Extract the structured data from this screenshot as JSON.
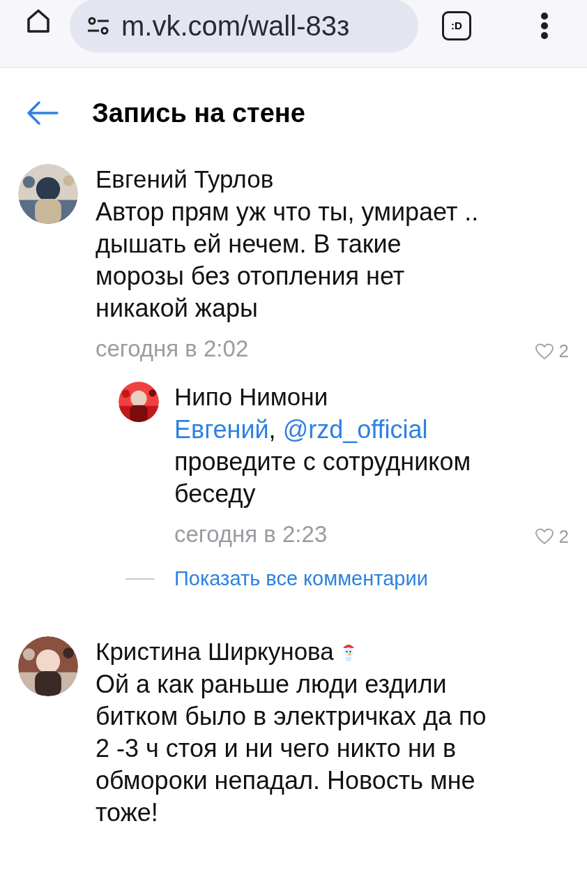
{
  "browser": {
    "url": "m.vk.com/wall-83з",
    "tab_switcher": ":D"
  },
  "header": {
    "title": "Запись на стене"
  },
  "comments": [
    {
      "kind": "comment",
      "author": "Евгений Турлов",
      "badge": false,
      "segments": [
        {
          "kind": "text",
          "text": "Автор прям уж что ты, умирает .. дышать ей нечем. В такие морозы без отопления нет никакой жары"
        }
      ],
      "time": "сегодня в 2:02",
      "likes": "2",
      "replies": [
        {
          "kind": "reply",
          "author": "Нипо Нимони",
          "badge": false,
          "segments": [
            {
              "kind": "link",
              "text": "Евгений",
              "suffix": ","
            },
            {
              "kind": "link",
              "text": "@rzd_official"
            },
            {
              "kind": "text",
              "text": "проведите с сотрудником беседу"
            }
          ],
          "time": "сегодня в 2:23",
          "likes": "2"
        }
      ],
      "show_all": "Показать все комментарии"
    },
    {
      "kind": "comment",
      "author": "Кристина Ширкунова",
      "badge": true,
      "segments": [
        {
          "kind": "text",
          "text": "Ой а как раньше люди ездили битком было в электричках да по 2 -3 ч стоя и ни чего никто ни в обмороки непадал. Новость мне тоже!"
        }
      ]
    }
  ]
}
